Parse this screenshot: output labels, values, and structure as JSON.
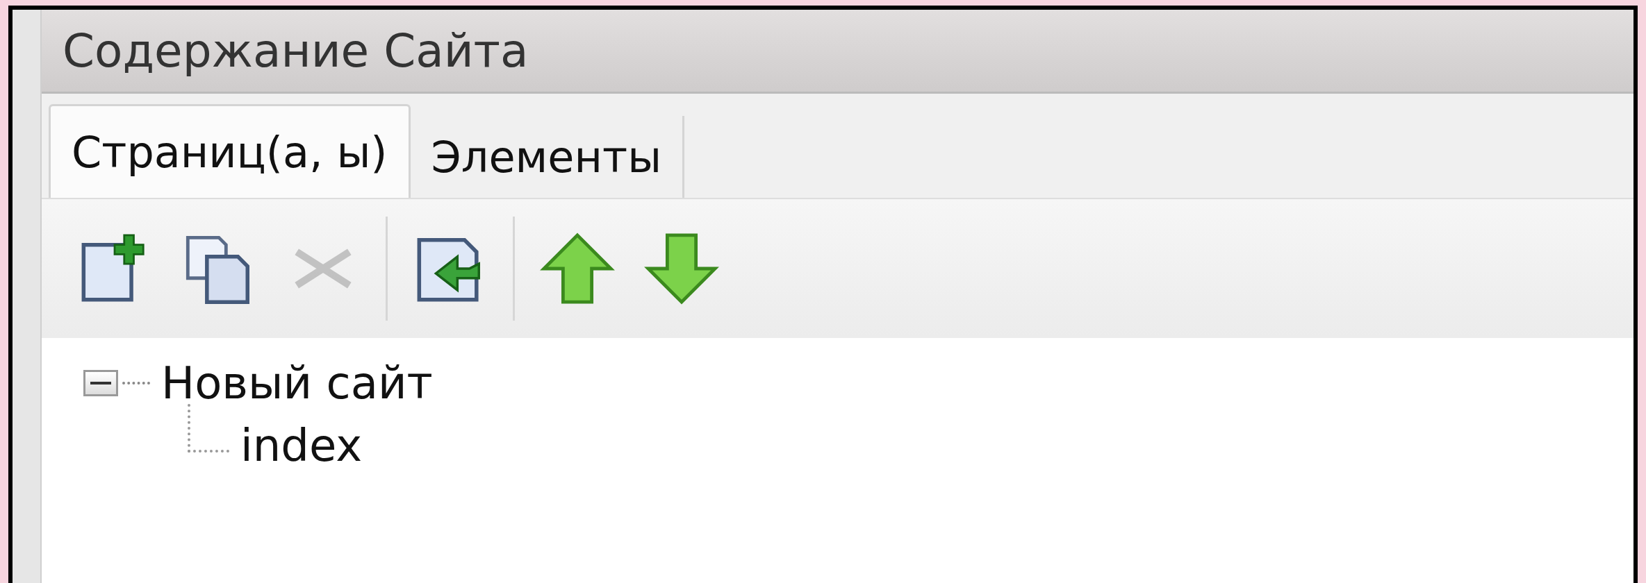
{
  "panel": {
    "title": "Содержание Сайта"
  },
  "tabs": [
    {
      "label": "Страниц(а, ы)",
      "selected": true
    },
    {
      "label": "Элементы",
      "selected": false
    }
  ],
  "toolbar": [
    {
      "kind": "new-page",
      "disabled": false
    },
    {
      "kind": "copy",
      "disabled": false
    },
    {
      "kind": "delete",
      "disabled": true
    },
    {
      "kind": "separator"
    },
    {
      "kind": "import",
      "disabled": false
    },
    {
      "kind": "separator"
    },
    {
      "kind": "up",
      "disabled": false
    },
    {
      "kind": "down",
      "disabled": false
    }
  ],
  "tree": [
    {
      "label": "Новый сайт",
      "expanded": true,
      "children": [
        {
          "label": "index"
        }
      ]
    }
  ]
}
